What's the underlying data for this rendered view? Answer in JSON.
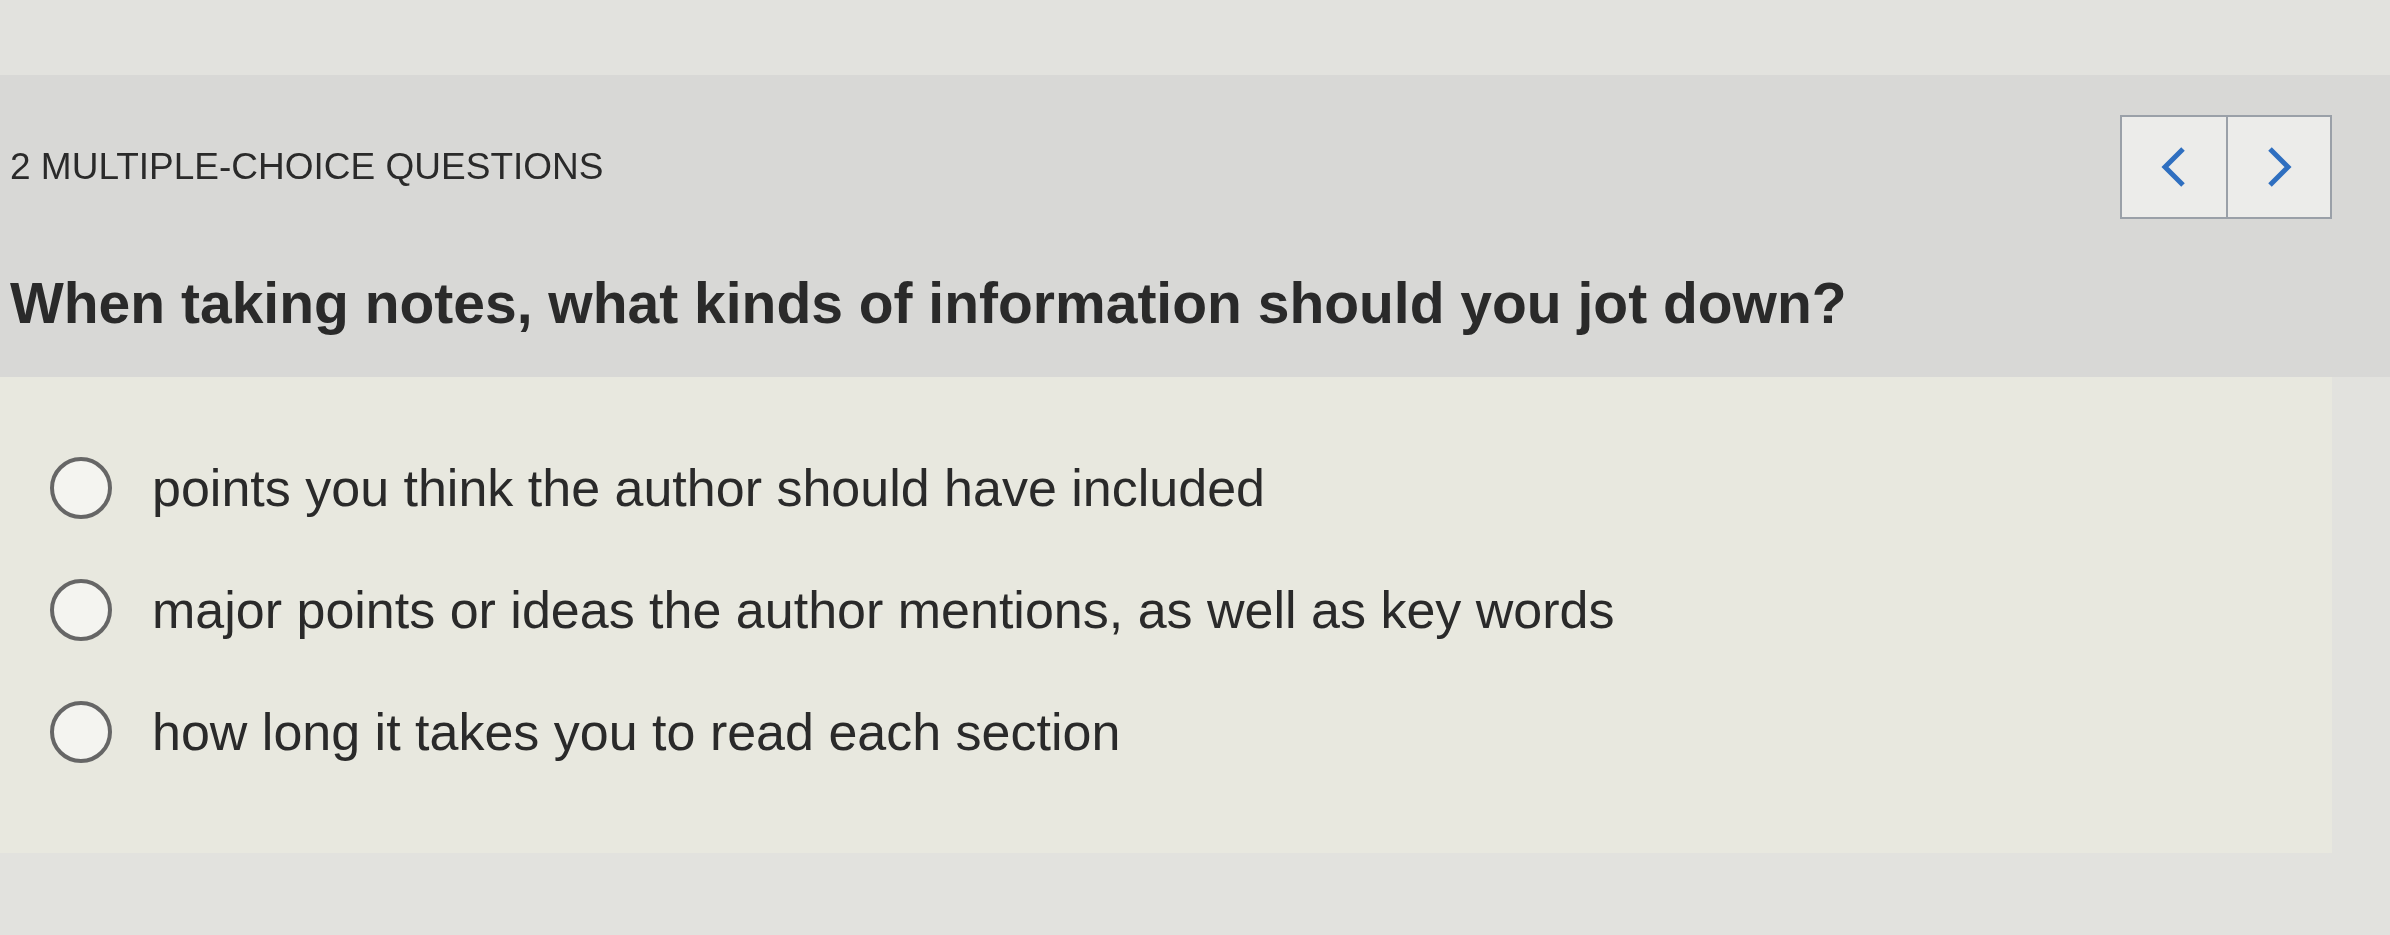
{
  "header": {
    "title": "2 MULTIPLE-CHOICE QUESTIONS"
  },
  "question": {
    "text": "When taking notes, what kinds of information should you jot down?"
  },
  "options": [
    {
      "label": "points you think the author should have included",
      "selected": false
    },
    {
      "label": "major points or ideas the author mentions, as well as key words",
      "selected": false
    },
    {
      "label": "how long it takes you to read each section",
      "selected": false
    }
  ]
}
